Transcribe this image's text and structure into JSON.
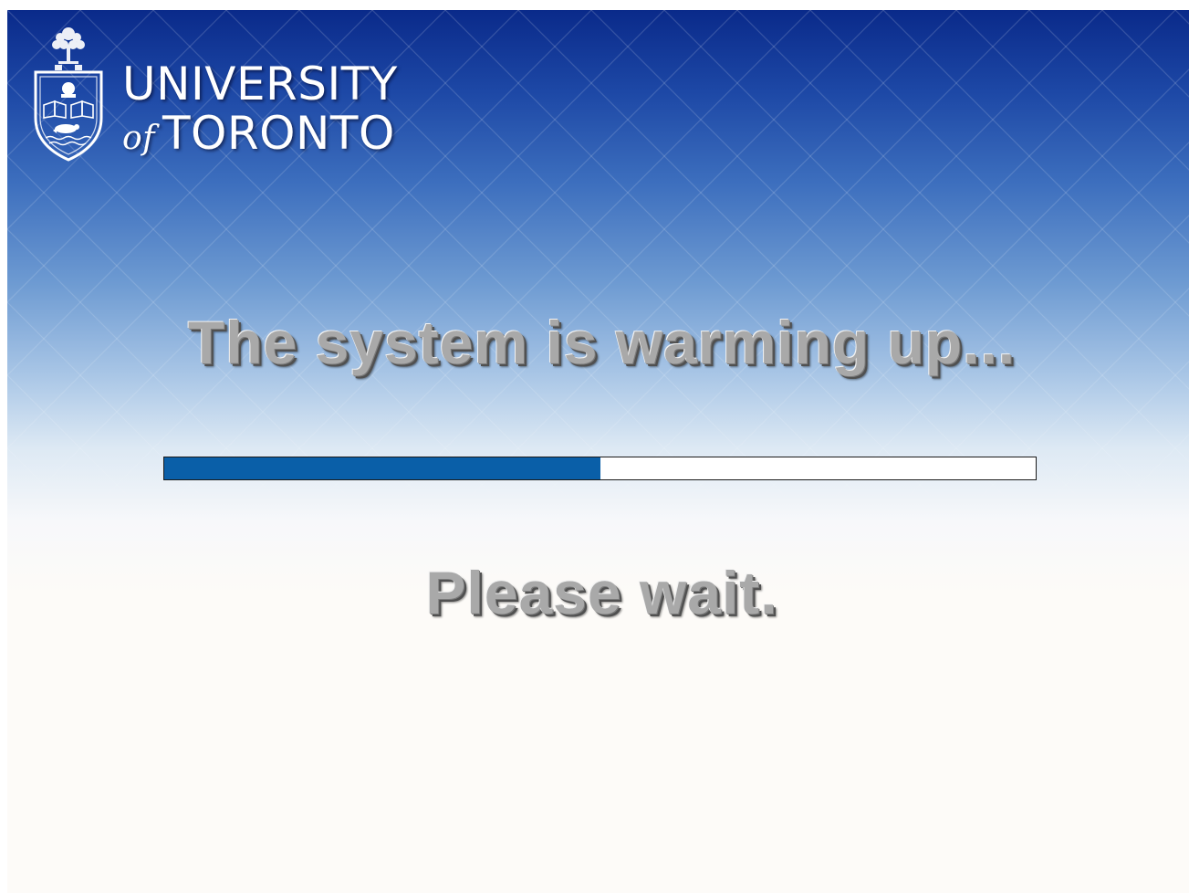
{
  "branding": {
    "name_line1": "UNIVERSITY",
    "name_of": "of",
    "name_line2": "TORONTO",
    "crest_icon": "university-crest-icon"
  },
  "status": {
    "headline": "The system is warming up...",
    "message": "Please wait."
  },
  "progress": {
    "percent": 50,
    "fill_color": "#0a5fa8"
  },
  "colors": {
    "background_top": "#0a2a8a",
    "background_bottom": "#fdfbf8",
    "text_gray": "#a9a9a9"
  }
}
